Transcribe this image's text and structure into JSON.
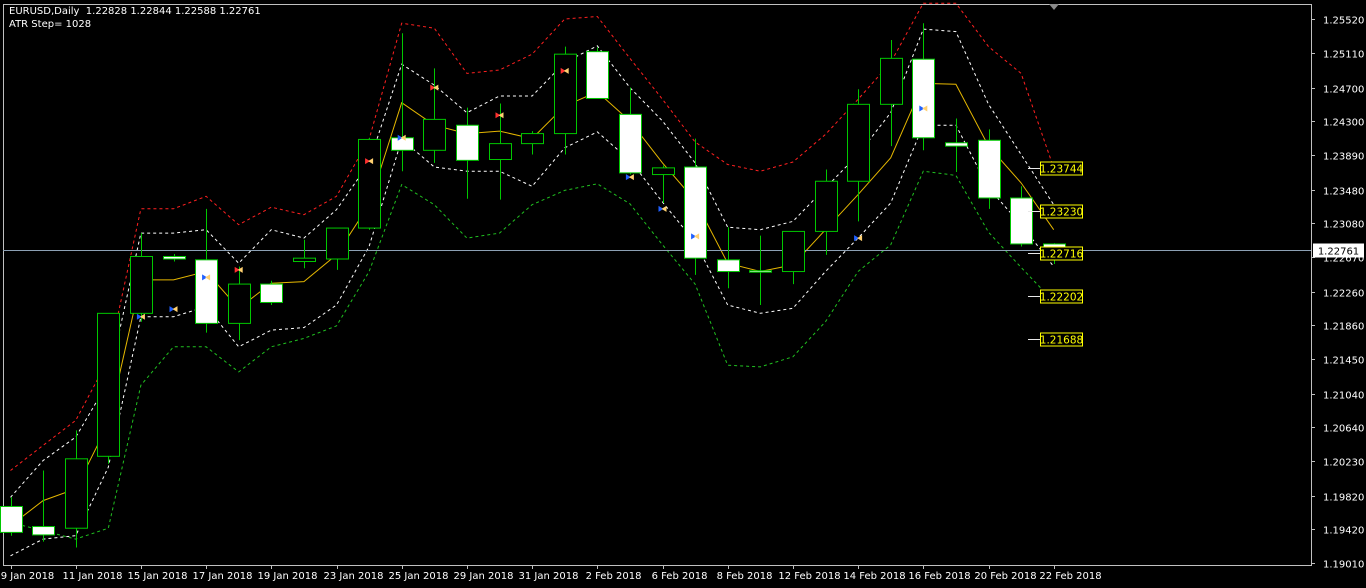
{
  "header": {
    "symbol_line": "EURUSD,Daily  1.22828 1.22844 1.22588 1.22761",
    "indicator_line": "ATR Step= 1028"
  },
  "colors": {
    "background": "#000000",
    "frame": "#c0c0c0",
    "bull_body": "#000000",
    "bear_body": "#ffffff",
    "candle_outline": "#00c800",
    "wick": "#00c800",
    "mid_line": "#e5b700",
    "inner_band": "#ffffff",
    "upper_band": "#ff2020",
    "lower_band": "#20c020",
    "level_label_bg": "#ffff00",
    "bid_line": "#8ca0b4"
  },
  "chart_data": {
    "type": "candlestick",
    "symbol": "EURUSD",
    "timeframe": "Daily",
    "last": {
      "open": 1.22828,
      "high": 1.22844,
      "low": 1.22588,
      "close": 1.22761
    },
    "ylim": [
      1.1899,
      1.257
    ],
    "y_ticks": [
      "1.25520",
      "1.25110",
      "1.24700",
      "1.24300",
      "1.23890",
      "1.23480",
      "1.23080",
      "1.22670",
      "1.22260",
      "1.21860",
      "1.21450",
      "1.21040",
      "1.20640",
      "1.20230",
      "1.19820",
      "1.19420",
      "1.19010"
    ],
    "x_ticks": [
      {
        "label": "9 Jan 2018",
        "index": 0
      },
      {
        "label": "11 Jan 2018",
        "index": 2
      },
      {
        "label": "15 Jan 2018",
        "index": 4
      },
      {
        "label": "17 Jan 2018",
        "index": 6
      },
      {
        "label": "19 Jan 2018",
        "index": 8
      },
      {
        "label": "23 Jan 2018",
        "index": 10
      },
      {
        "label": "25 Jan 2018",
        "index": 12
      },
      {
        "label": "29 Jan 2018",
        "index": 14
      },
      {
        "label": "31 Jan 2018",
        "index": 16
      },
      {
        "label": "2 Feb 2018",
        "index": 18
      },
      {
        "label": "6 Feb 2018",
        "index": 20
      },
      {
        "label": "8 Feb 2018",
        "index": 22
      },
      {
        "label": "12 Feb 2018",
        "index": 24
      },
      {
        "label": "14 Feb 2018",
        "index": 26
      },
      {
        "label": "16 Feb 2018",
        "index": 28
      },
      {
        "label": "20 Feb 2018",
        "index": 30
      },
      {
        "label": "22 Feb 2018",
        "index": 32
      }
    ],
    "candles": [
      {
        "o": 1.1969,
        "h": 1.198,
        "l": 1.1934,
        "c": 1.1938
      },
      {
        "o": 1.1945,
        "h": 1.2012,
        "l": 1.1927,
        "c": 1.1935
      },
      {
        "o": 1.1943,
        "h": 1.206,
        "l": 1.192,
        "c": 1.2026
      },
      {
        "o": 1.2029,
        "h": 1.214,
        "l": 1.202,
        "c": 1.22
      },
      {
        "o": 1.22,
        "h": 1.2296,
        "l": 1.219,
        "c": 1.2268
      },
      {
        "o": 1.2268,
        "h": 1.2271,
        "l": 1.2262,
        "c": 1.2265
      },
      {
        "o": 1.2264,
        "h": 1.2325,
        "l": 1.2177,
        "c": 1.2188
      },
      {
        "o": 1.2188,
        "h": 1.2256,
        "l": 1.2168,
        "c": 1.2235
      },
      {
        "o": 1.2235,
        "h": 1.2239,
        "l": 1.221,
        "c": 1.2213
      },
      {
        "o": 1.2262,
        "h": 1.2288,
        "l": 1.2254,
        "c": 1.2266
      },
      {
        "o": 1.2265,
        "h": 1.229,
        "l": 1.2252,
        "c": 1.2302
      },
      {
        "o": 1.2302,
        "h": 1.241,
        "l": 1.23,
        "c": 1.2408
      },
      {
        "o": 1.241,
        "h": 1.2535,
        "l": 1.237,
        "c": 1.2395
      },
      {
        "o": 1.2395,
        "h": 1.2493,
        "l": 1.238,
        "c": 1.2432
      },
      {
        "o": 1.2425,
        "h": 1.2446,
        "l": 1.2337,
        "c": 1.2383
      },
      {
        "o": 1.2384,
        "h": 1.2451,
        "l": 1.2336,
        "c": 1.2403
      },
      {
        "o": 1.2403,
        "h": 1.2418,
        "l": 1.239,
        "c": 1.2415
      },
      {
        "o": 1.2415,
        "h": 1.2519,
        "l": 1.239,
        "c": 1.251
      },
      {
        "o": 1.2513,
        "h": 1.2518,
        "l": 1.2457,
        "c": 1.2457
      },
      {
        "o": 1.2438,
        "h": 1.247,
        "l": 1.2366,
        "c": 1.2368
      },
      {
        "o": 1.2366,
        "h": 1.2377,
        "l": 1.2332,
        "c": 1.2374
      },
      {
        "o": 1.2375,
        "h": 1.2409,
        "l": 1.2246,
        "c": 1.2266
      },
      {
        "o": 1.2264,
        "h": 1.2303,
        "l": 1.223,
        "c": 1.225
      },
      {
        "o": 1.2251,
        "h": 1.2293,
        "l": 1.221,
        "c": 1.225
      },
      {
        "o": 1.225,
        "h": 1.229,
        "l": 1.2235,
        "c": 1.2298
      },
      {
        "o": 1.2298,
        "h": 1.2372,
        "l": 1.227,
        "c": 1.2358
      },
      {
        "o": 1.2358,
        "h": 1.2468,
        "l": 1.231,
        "c": 1.245
      },
      {
        "o": 1.245,
        "h": 1.2527,
        "l": 1.24,
        "c": 1.2505
      },
      {
        "o": 1.2504,
        "h": 1.2547,
        "l": 1.2395,
        "c": 1.241
      },
      {
        "o": 1.2404,
        "h": 1.2433,
        "l": 1.2369,
        "c": 1.24
      },
      {
        "o": 1.2407,
        "h": 1.242,
        "l": 1.2325,
        "c": 1.2338
      },
      {
        "o": 1.2338,
        "h": 1.2352,
        "l": 1.228,
        "c": 1.2283
      },
      {
        "o": 1.2283,
        "h": 1.2284,
        "l": 1.2259,
        "c": 1.2276
      }
    ],
    "mid_line": [
      1.1946,
      1.1976,
      1.199,
      1.2068,
      1.224,
      1.224,
      1.225,
      1.2206,
      1.2236,
      1.2238,
      1.227,
      1.233,
      1.2452,
      1.2425,
      1.2415,
      1.2418,
      1.2409,
      1.2448,
      1.2465,
      1.243,
      1.238,
      1.2335,
      1.226,
      1.225,
      1.2258,
      1.23,
      1.2342,
      1.2386,
      1.2475,
      1.2474,
      1.24,
      1.2356,
      1.23
    ],
    "inner_upper": [
      1.198,
      1.2024,
      1.2052,
      1.2118,
      1.2296,
      1.2296,
      1.23,
      1.226,
      1.23,
      1.229,
      1.2324,
      1.238,
      1.2498,
      1.2473,
      1.244,
      1.246,
      1.246,
      1.25,
      1.252,
      1.247,
      1.243,
      1.238,
      1.2303,
      1.23,
      1.231,
      1.235,
      1.239,
      1.244,
      1.254,
      1.2537,
      1.245,
      1.239,
      1.233
    ],
    "inner_lower": [
      1.191,
      1.193,
      1.1934,
      1.2016,
      1.2196,
      1.2196,
      1.2208,
      1.216,
      1.218,
      1.2183,
      1.221,
      1.228,
      1.2408,
      1.2375,
      1.237,
      1.237,
      1.2352,
      1.2398,
      1.2417,
      1.2383,
      1.2333,
      1.2285,
      1.221,
      1.22,
      1.2206,
      1.225,
      1.229,
      1.2332,
      1.2425,
      1.2425,
      1.235,
      1.2306,
      1.2256
    ],
    "outer_upper": [
      1.2012,
      1.2042,
      1.2072,
      1.2145,
      1.2325,
      1.2325,
      1.234,
      1.2306,
      1.2327,
      1.2318,
      1.234,
      1.2408,
      1.2547,
      1.2541,
      1.2487,
      1.2491,
      1.251,
      1.2552,
      1.2555,
      1.2505,
      1.2456,
      1.2405,
      1.2378,
      1.237,
      1.2381,
      1.2414,
      1.2456,
      1.25,
      1.2571,
      1.2571,
      1.2519,
      1.2487,
      1.2374
    ],
    "outer_lower": [
      1.195,
      1.194,
      1.193,
      1.1943,
      1.2114,
      1.216,
      1.216,
      1.213,
      1.216,
      1.217,
      1.2185,
      1.225,
      1.2354,
      1.233,
      1.229,
      1.2296,
      1.233,
      1.2347,
      1.2355,
      1.2331,
      1.2282,
      1.2235,
      1.2138,
      1.2136,
      1.2148,
      1.219,
      1.225,
      1.2282,
      1.237,
      1.2365,
      1.2297,
      1.2255,
      1.2214
    ],
    "markers": [
      {
        "index": 4,
        "price": 1.2196,
        "kind": "buy"
      },
      {
        "index": 5,
        "price": 1.2205,
        "kind": "buy"
      },
      {
        "index": 6,
        "price": 1.2243,
        "kind": "buy"
      },
      {
        "index": 7,
        "price": 1.2252,
        "kind": "sell"
      },
      {
        "index": 11,
        "price": 1.2382,
        "kind": "sell"
      },
      {
        "index": 12,
        "price": 1.241,
        "kind": "buy"
      },
      {
        "index": 13,
        "price": 1.247,
        "kind": "sell"
      },
      {
        "index": 15,
        "price": 1.2437,
        "kind": "sell"
      },
      {
        "index": 17,
        "price": 1.249,
        "kind": "sell"
      },
      {
        "index": 19,
        "price": 1.2363,
        "kind": "buy"
      },
      {
        "index": 20,
        "price": 1.2325,
        "kind": "buy"
      },
      {
        "index": 21,
        "price": 1.2292,
        "kind": "buy"
      },
      {
        "index": 26,
        "price": 1.229,
        "kind": "buy"
      },
      {
        "index": 28,
        "price": 1.2445,
        "kind": "buy"
      }
    ],
    "level_labels": [
      {
        "text": "1.23744",
        "price": 1.23744
      },
      {
        "text": "1.23230",
        "price": 1.2323
      },
      {
        "text": "1.22716",
        "price": 1.22716
      },
      {
        "text": "1.22202",
        "price": 1.22202
      },
      {
        "text": "1.21688",
        "price": 1.21688
      }
    ],
    "bid": {
      "text": "1.22761",
      "price": 1.22761
    },
    "grid": false
  }
}
